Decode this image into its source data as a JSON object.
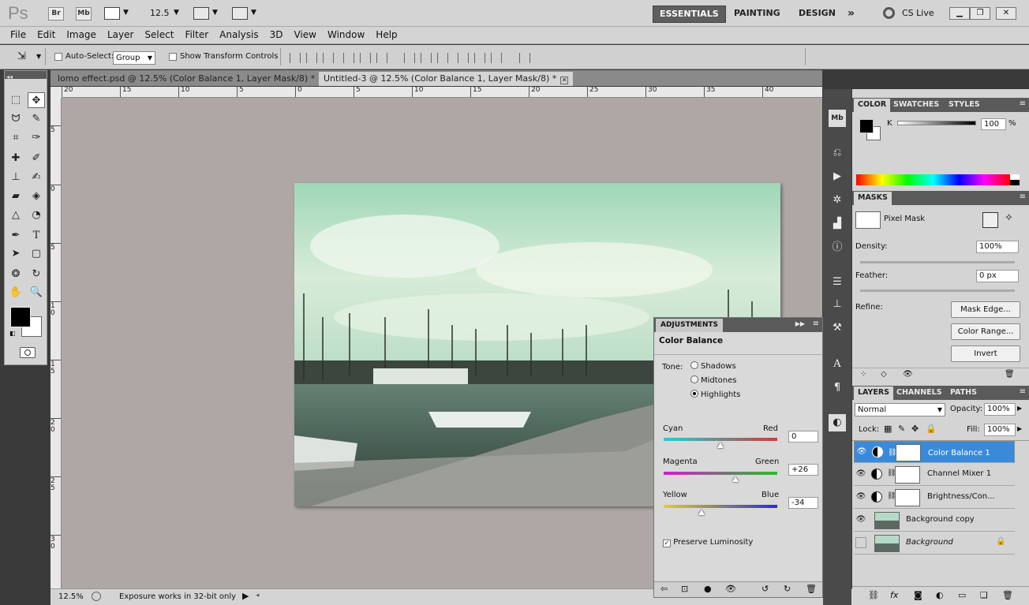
{
  "app": {
    "logo": "Ps",
    "bridge": "Br",
    "minibridge": "Mb",
    "zoom": "12.5",
    "workspaces": [
      "ESSENTIALS",
      "PAINTING",
      "DESIGN"
    ],
    "more": "»",
    "cslive": "CS Live"
  },
  "menu": [
    "File",
    "Edit",
    "Image",
    "Layer",
    "Select",
    "Filter",
    "Analysis",
    "3D",
    "View",
    "Window",
    "Help"
  ],
  "options": {
    "auto_select_label": "Auto-Select:",
    "auto_select_value": "Group",
    "transform_label": "Show Transform Controls"
  },
  "tabs": [
    {
      "label": "lomo effect.psd @ 12.5% (Color Balance 1, Layer Mask/8) *",
      "active": false
    },
    {
      "label": "Untitled-3 @ 12.5% (Color Balance 1, Layer Mask/8) *",
      "active": true
    }
  ],
  "ruler_h": [
    "20",
    "15",
    "10",
    "5",
    "0",
    "5",
    "10",
    "15",
    "20",
    "25",
    "30",
    "35",
    "40"
  ],
  "ruler_v": [
    "5",
    "0",
    "5",
    "1 0",
    "1 5",
    "2 0",
    "2 5",
    "3 0"
  ],
  "status": {
    "zoom": "12.5%",
    "info": "Exposure works in 32-bit only"
  },
  "adjustments": {
    "tab": "ADJUSTMENTS",
    "title": "Color Balance",
    "tone_label": "Tone:",
    "tones": [
      {
        "label": "Shadows",
        "on": false
      },
      {
        "label": "Midtones",
        "on": false
      },
      {
        "label": "Highlights",
        "on": true
      }
    ],
    "sliders": [
      {
        "left": "Cyan",
        "right": "Red",
        "value": "0",
        "pos": 0.5
      },
      {
        "left": "Magenta",
        "right": "Green",
        "value": "+26",
        "pos": 0.63
      },
      {
        "left": "Yellow",
        "right": "Blue",
        "value": "-34",
        "pos": 0.33
      }
    ],
    "preserve": "Preserve Luminosity"
  },
  "color_panel": {
    "tabs": [
      "COLOR",
      "SWATCHES",
      "STYLES"
    ],
    "channel": "K",
    "value": "100",
    "unit": "%"
  },
  "masks": {
    "tab": "MASKS",
    "mask_label": "Pixel Mask",
    "density_label": "Density:",
    "density": "100%",
    "feather_label": "Feather:",
    "feather": "0 px",
    "refine_label": "Refine:",
    "buttons": [
      "Mask Edge...",
      "Color Range...",
      "Invert"
    ]
  },
  "layers": {
    "tabs": [
      "LAYERS",
      "CHANNELS",
      "PATHS"
    ],
    "blend": "Normal",
    "opacity_label": "Opacity:",
    "opacity": "100%",
    "lock_label": "Lock:",
    "fill_label": "Fill:",
    "fill": "100%",
    "items": [
      {
        "name": "Color Balance 1",
        "type": "adj",
        "selected": true,
        "visible": true
      },
      {
        "name": "Channel Mixer 1",
        "type": "adj",
        "selected": false,
        "visible": true
      },
      {
        "name": "Brightness/Con...",
        "type": "adj",
        "selected": false,
        "visible": true
      },
      {
        "name": "Background copy",
        "type": "img",
        "selected": false,
        "visible": true
      },
      {
        "name": "Background",
        "type": "img",
        "selected": false,
        "visible": false
      }
    ]
  }
}
